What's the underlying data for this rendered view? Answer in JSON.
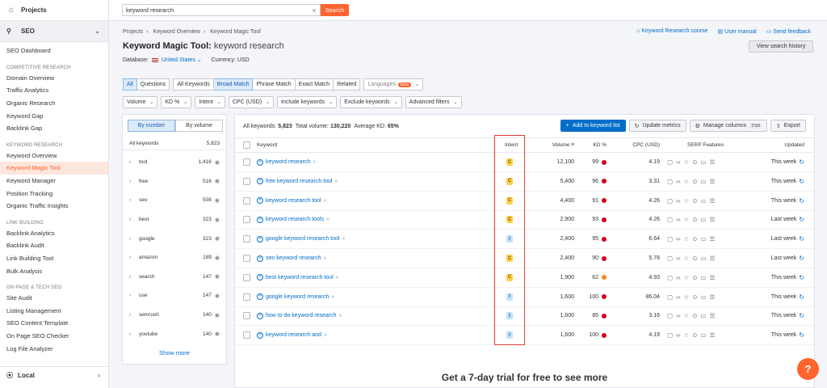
{
  "sidebar": {
    "projects": "Projects",
    "seo": "SEO",
    "local": "Local",
    "items": [
      {
        "type": "item",
        "label": "SEO Dashboard"
      },
      {
        "type": "section",
        "label": "COMPETITIVE RESEARCH"
      },
      {
        "type": "item",
        "label": "Domain Overview"
      },
      {
        "type": "item",
        "label": "Traffic Analytics"
      },
      {
        "type": "item",
        "label": "Organic Research"
      },
      {
        "type": "item",
        "label": "Keyword Gap"
      },
      {
        "type": "item",
        "label": "Backlink Gap"
      },
      {
        "type": "section",
        "label": "KEYWORD RESEARCH"
      },
      {
        "type": "item",
        "label": "Keyword Overview"
      },
      {
        "type": "item",
        "label": "Keyword Magic Tool",
        "active": true
      },
      {
        "type": "item",
        "label": "Keyword Manager"
      },
      {
        "type": "item",
        "label": "Position Tracking"
      },
      {
        "type": "item",
        "label": "Organic Traffic Insights"
      },
      {
        "type": "section",
        "label": "LINK BUILDING"
      },
      {
        "type": "item",
        "label": "Backlink Analytics"
      },
      {
        "type": "item",
        "label": "Backlink Audit"
      },
      {
        "type": "item",
        "label": "Link Building Tool"
      },
      {
        "type": "item",
        "label": "Bulk Analysis"
      },
      {
        "type": "section",
        "label": "ON PAGE & TECH SEO"
      },
      {
        "type": "item",
        "label": "Site Audit"
      },
      {
        "type": "item",
        "label": "Listing Management"
      },
      {
        "type": "item",
        "label": "SEO Content Template"
      },
      {
        "type": "item",
        "label": "On Page SEO Checker"
      },
      {
        "type": "item",
        "label": "Log File Analyzer"
      }
    ]
  },
  "search": {
    "value": "keyword research",
    "button": "Search"
  },
  "breadcrumbs": [
    "Projects",
    "Keyword Overview",
    "Keyword Magic Tool"
  ],
  "page": {
    "title": "Keyword Magic Tool:",
    "query": "keyword research",
    "database_label": "Database:",
    "database_value": "United States",
    "currency": "Currency: USD"
  },
  "toplinks": {
    "course": "Keyword Research course",
    "manual": "User manual",
    "feedback": "Send feedback",
    "history": "View search history"
  },
  "filters1": {
    "g1": [
      "All",
      "Questions"
    ],
    "g2": [
      "All Keywords",
      "Broad Match",
      "Phrase Match",
      "Exact Match",
      "Related"
    ],
    "languages": "Languages",
    "beta": "beta"
  },
  "filters2": [
    "Volume",
    "KD %",
    "Intent",
    "CPC (USD)",
    "Include keywords",
    "Exclude keywords",
    "Advanced filters"
  ],
  "leftpanel": {
    "by_number": "By number",
    "by_volume": "By volume",
    "head_label": "All keywords",
    "head_count": "5,823",
    "groups": [
      {
        "name": "tool",
        "count": "1,416"
      },
      {
        "name": "free",
        "count": "516"
      },
      {
        "name": "seo",
        "count": "508"
      },
      {
        "name": "best",
        "count": "323"
      },
      {
        "name": "google",
        "count": "323"
      },
      {
        "name": "amazon",
        "count": "189"
      },
      {
        "name": "search",
        "count": "147"
      },
      {
        "name": "use",
        "count": "147"
      },
      {
        "name": "semrush",
        "count": "140"
      },
      {
        "name": "youtube",
        "count": "140"
      }
    ],
    "show_more": "Show more"
  },
  "summary": {
    "all_label": "All keywords:",
    "all_value": "5,823",
    "vol_label": "Total volume:",
    "vol_value": "130,220",
    "kd_label": "Average KD:",
    "kd_value": "65%"
  },
  "actions": {
    "add": "Add to keyword list",
    "update": "Update metrics",
    "manage": "Manage columns",
    "manage_badge": "7/10",
    "export": "Export"
  },
  "columns": {
    "keyword": "Keyword",
    "intent": "Intent",
    "volume": "Volume",
    "kd": "KD %",
    "cpc": "CPC (USD)",
    "serp": "SERP Features",
    "updated": "Updated"
  },
  "rows": [
    {
      "kw": "keyword research",
      "intent": "C",
      "vol": "12,100",
      "kd": "99",
      "kdc": "#d0021b",
      "cpc": "4.19",
      "upd": "This week"
    },
    {
      "kw": "free keyword research tool",
      "intent": "C",
      "vol": "5,400",
      "kd": "96",
      "kdc": "#d0021b",
      "cpc": "3.31",
      "upd": "This week"
    },
    {
      "kw": "keyword research tool",
      "intent": "C",
      "vol": "4,400",
      "kd": "91",
      "kdc": "#d0021b",
      "cpc": "4.26",
      "upd": "This week"
    },
    {
      "kw": "keyword research tools",
      "intent": "C",
      "vol": "2,900",
      "kd": "93",
      "kdc": "#d0021b",
      "cpc": "4.26",
      "upd": "Last week"
    },
    {
      "kw": "google keyword research tool",
      "intent": "I",
      "vol": "2,400",
      "kd": "95",
      "kdc": "#d0021b",
      "cpc": "6.64",
      "upd": "Last week"
    },
    {
      "kw": "seo keyword research",
      "intent": "C",
      "vol": "2,400",
      "kd": "90",
      "kdc": "#d0021b",
      "cpc": "5.78",
      "upd": "Last week"
    },
    {
      "kw": "best keyword research tool",
      "intent": "C",
      "vol": "1,900",
      "kd": "62",
      "kdc": "#f5871f",
      "cpc": "4.93",
      "upd": "This week"
    },
    {
      "kw": "google keyword research",
      "intent": "I",
      "vol": "1,600",
      "kd": "100",
      "kdc": "#d0021b",
      "cpc": "86.04",
      "upd": "This week"
    },
    {
      "kw": "how to do keyword research",
      "intent": "I",
      "vol": "1,600",
      "kd": "85",
      "kdc": "#d0021b",
      "cpc": "3.16",
      "upd": "This week"
    },
    {
      "kw": "keyword research and",
      "intent": "I",
      "vol": "1,600",
      "kd": "100",
      "kdc": "#d0021b",
      "cpc": "4.19",
      "upd": "This week"
    }
  ],
  "cta": "Get a 7-day trial for free to see more",
  "help": "?"
}
